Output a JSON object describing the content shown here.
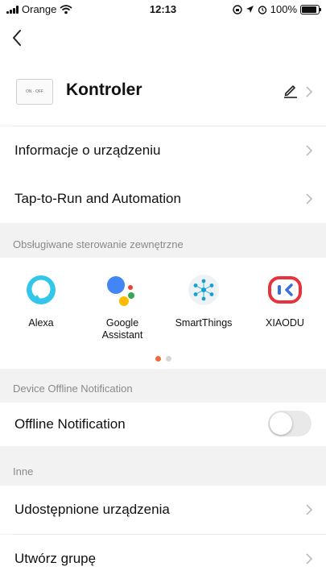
{
  "status_bar": {
    "carrier": "Orange",
    "time": "12:13",
    "battery_percent": "100%",
    "battery_level": 1.0
  },
  "device": {
    "name": "Kontroler",
    "thumb_text": "ON · OFF"
  },
  "rows": {
    "info": "Informacje o urządzeniu",
    "tap_to_run": "Tap-to-Run and Automation"
  },
  "integrations": {
    "section_label": "Obsługiwane sterowanie zewnętrzne",
    "items": [
      {
        "label": "Alexa",
        "icon": "alexa-icon"
      },
      {
        "label": "Google\nAssistant",
        "icon": "google-assistant-icon"
      },
      {
        "label": "SmartThings",
        "icon": "smartthings-icon"
      },
      {
        "label": "XIAODU",
        "icon": "xiaodu-icon"
      }
    ],
    "page_count": 2,
    "active_page": 1
  },
  "offline": {
    "section_label": "Device Offline Notification",
    "label": "Offline Notification",
    "enabled": false
  },
  "other": {
    "section_label": "Inne",
    "shared_devices": "Udostępnione urządzenia",
    "create_group": "Utwórz grupę"
  },
  "colors": {
    "accent": "#ee6e3a",
    "alexa": "#31c6ea",
    "xiaodu": "#e8323c",
    "toggle_off": "#e9e9ea"
  }
}
